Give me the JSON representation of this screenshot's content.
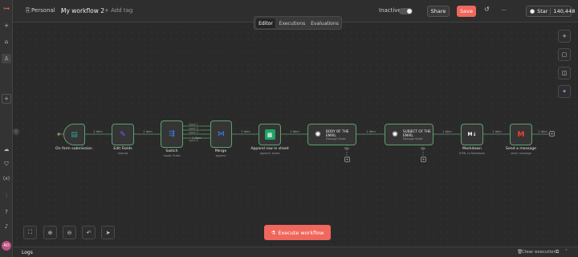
{
  "header": {
    "project": "Personal",
    "workflow_name": "My workflow 2",
    "add_tag": "+ Add tag",
    "status": "Inactive",
    "share_label": "Share",
    "save_label": "Save",
    "more_label": "···",
    "github_label": "Star",
    "github_count": "140,448"
  },
  "tabs": [
    {
      "label": "Editor",
      "active": true
    },
    {
      "label": "Executions",
      "active": false
    },
    {
      "label": "Evaluations",
      "active": false
    }
  ],
  "nodes": [
    {
      "id": "form",
      "label": "On form submission",
      "sub": "",
      "icon": "form-icon",
      "color": "#2aa58f"
    },
    {
      "id": "edit",
      "label": "Edit Fields",
      "sub": "manual",
      "icon": "pencil-icon",
      "color": "#7a5af8"
    },
    {
      "id": "switch",
      "label": "Switch",
      "sub": "mode: Rules",
      "icon": "switch-icon",
      "color": "#3b82f6"
    },
    {
      "id": "merge",
      "label": "Merge",
      "sub": "append",
      "icon": "merge-icon",
      "color": "#3b82f6"
    },
    {
      "id": "sheet",
      "label": "Append row in sheet",
      "sub": "append: sheet",
      "icon": "sheets-icon",
      "color": "#1fa463"
    },
    {
      "id": "ai1",
      "label": "BODY OF THE EMAIL",
      "sub": "Message Model",
      "icon": "openai-icon",
      "color": "#ffffff",
      "port": "Tool"
    },
    {
      "id": "ai2",
      "label": "SUBJECT OF THE EMAIL",
      "sub": "Message Model",
      "icon": "openai-icon",
      "color": "#ffffff",
      "port": "Tool"
    },
    {
      "id": "md",
      "label": "Markdown",
      "sub": "HTML to Markdown",
      "icon": "markdown-icon",
      "color": "#ffffff"
    },
    {
      "id": "gmail",
      "label": "Send a message",
      "sub": "send: message",
      "icon": "gmail-icon",
      "color": "#ea4335"
    }
  ],
  "edges": [
    {
      "from": "form",
      "to": "edit",
      "label": "1 item"
    },
    {
      "from": "edit",
      "to": "switch",
      "label": "1 item"
    },
    {
      "from": "switch",
      "to": "merge",
      "label": "1 item"
    },
    {
      "from": "merge",
      "to": "sheet",
      "label": "1 item"
    },
    {
      "from": "sheet",
      "to": "ai1",
      "label": "1 item"
    },
    {
      "from": "ai1",
      "to": "ai2",
      "label": "1 item"
    },
    {
      "from": "ai2",
      "to": "md",
      "label": "1 item"
    },
    {
      "from": "md",
      "to": "gmail",
      "label": "1 item"
    },
    {
      "from": "gmail",
      "to": "end",
      "label": "1 item"
    }
  ],
  "switch_outputs": [
    "input 1",
    "input 2",
    "input 3",
    "input 4"
  ],
  "toolbar": {
    "execute_label": "Execute workflow"
  },
  "logs": {
    "title": "Logs",
    "clear_label": "Clear execution"
  },
  "colors": {
    "accent": "#f0675c",
    "edge": "#5fa06e"
  }
}
